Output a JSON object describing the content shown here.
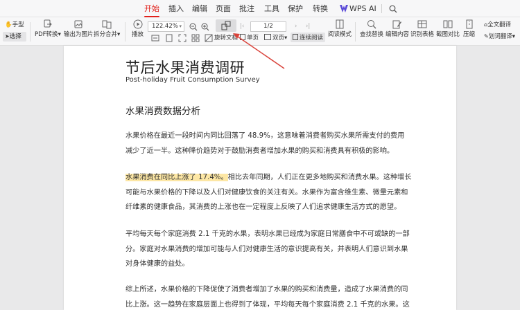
{
  "tabs": [
    {
      "label": "开始",
      "active": true
    },
    {
      "label": "插入"
    },
    {
      "label": "编辑"
    },
    {
      "label": "页面"
    },
    {
      "label": "批注"
    },
    {
      "label": "工具"
    },
    {
      "label": "保护"
    },
    {
      "label": "转换"
    },
    {
      "label": "WPS AI"
    }
  ],
  "toolbar": {
    "hand_label": "手型",
    "select_label": "选择",
    "pdf_convert_label": "PDF转换",
    "export_image_label": "输出为图片",
    "split_merge_label": "拆分合并",
    "play_label": "播放",
    "zoom_value": "122.42%",
    "page_value": "1/2",
    "rotate_label": "旋转文档",
    "single_page_label": "单页",
    "double_page_label": "双页",
    "continuous_label": "连续阅读",
    "read_mode_label": "阅读模式",
    "find_replace_label": "查找替换",
    "edit_content_label": "编辑内容",
    "recognize_table_label": "识别表格",
    "screenshot_compare_label": "截图对比",
    "compress_label": "压缩",
    "full_translate_label": "全文翻译",
    "word_translate_label": "划词翻译"
  },
  "document": {
    "title": "节后水果消费调研",
    "subtitle": "Post-holiday Fruit Consumption Survey",
    "heading": "水果消费数据分析",
    "p1": [
      "水果价格在最近一段时间内同比回落了 48.9%，这意味着消费者购买水果所需支付的费用",
      "减少了近一半。这种降价趋势对于鼓励消费者增加水果的购买和消费具有积极的影响。"
    ],
    "p2_highlight": "水果消费在同比上涨了 17.4%。",
    "p2_first_rest": "相比去年同期，人们正在更多地购买和消费水果。这种增长",
    "p2_rest": [
      "可能与水果价格的下降以及人们对健康饮食的关注有关。水果作为富含维生素、微量元素和",
      "纤维素的健康食品，其消费的上涨也在一定程度上反映了人们追求健康生活方式的愿望。"
    ],
    "p3": [
      "平均每天每个家庭消费 2.1 千克的水果，表明水果已经成为家庭日常膳食中不可或缺的一部",
      "分。家庭对水果消费的增加可能与人们对健康生活的意识提高有关，并表明人们意识到水果",
      "对身体健康的益处。"
    ],
    "p4": [
      "综上所述，水果价格的下降促使了消费者增加了水果的购买和消费量，造成了水果消费的同",
      "比上涨。这一趋势在家庭层面上也得到了体现，平均每天每个家庭消费 2.1 千克的水果。这"
    ]
  },
  "colors": {
    "accent": "#e1211b",
    "highlight": "#fde7a5",
    "annotation_arrow": "#d9423a"
  },
  "icons": [
    "hand-icon",
    "cursor-icon",
    "pdf-convert-icon",
    "export-image-icon",
    "split-merge-icon",
    "play-icon",
    "zoom-out-icon",
    "zoom-in-icon",
    "rotate-icon",
    "first-page-icon",
    "prev-page-icon",
    "next-page-icon",
    "last-page-icon",
    "single-page-icon",
    "double-page-icon",
    "continuous-icon",
    "read-mode-icon",
    "find-replace-icon",
    "edit-content-icon",
    "recognize-table-icon",
    "screenshot-compare-icon",
    "compress-icon",
    "translate-icon",
    "search-icon"
  ]
}
